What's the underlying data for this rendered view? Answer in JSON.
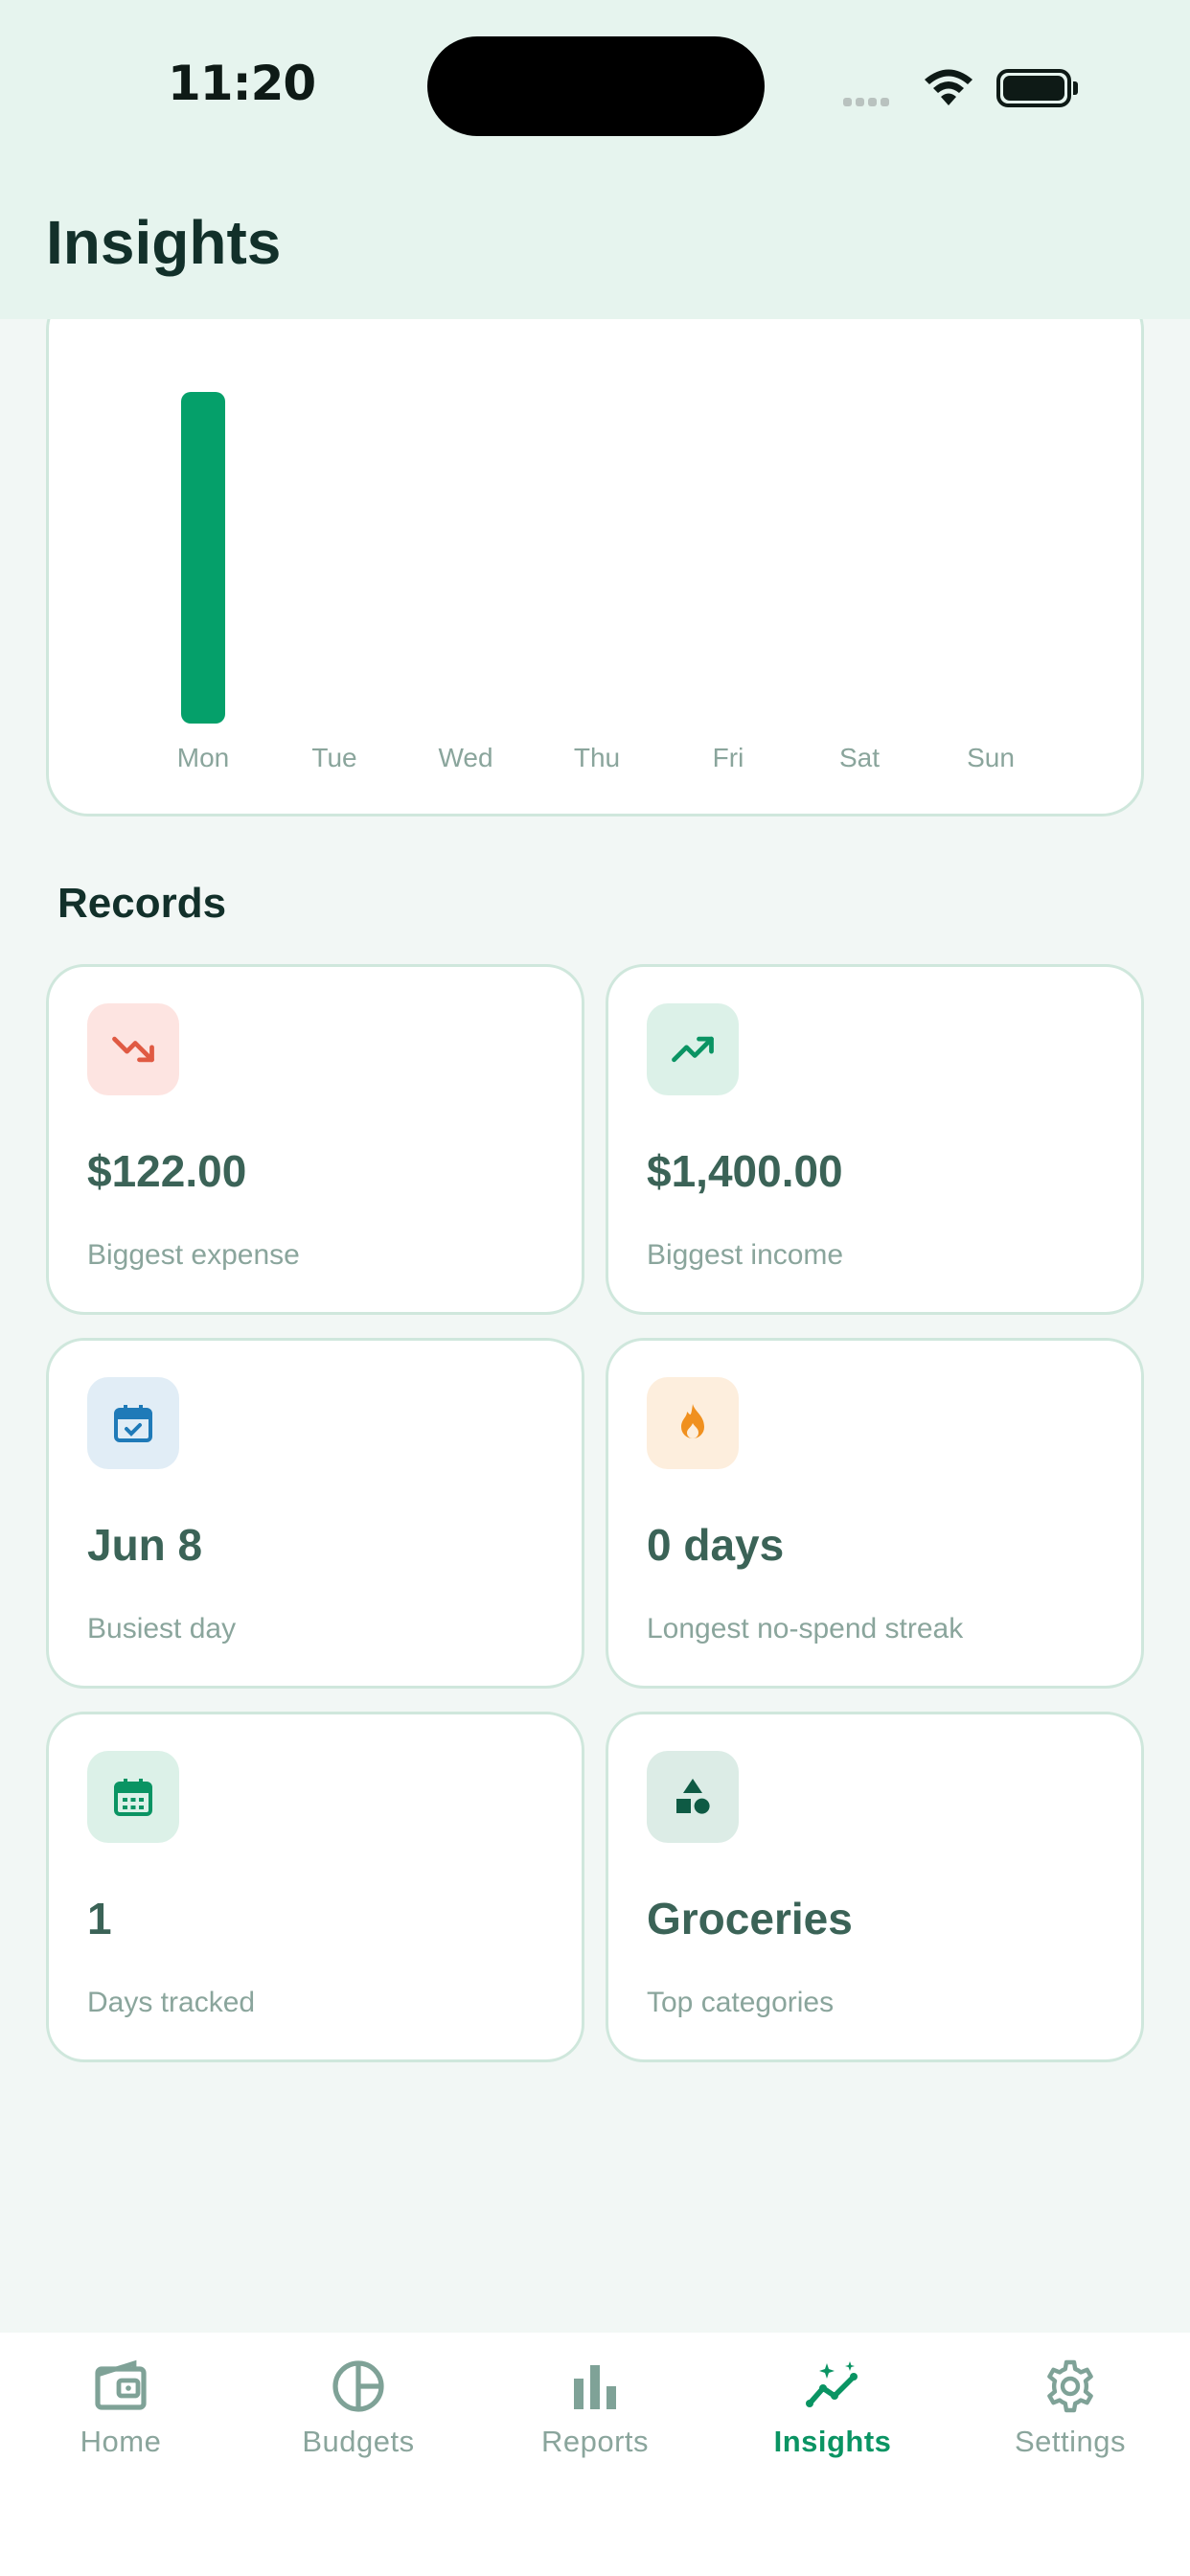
{
  "status_bar": {
    "time": "11:20"
  },
  "header": {
    "title": "Insights"
  },
  "chart_data": {
    "type": "bar",
    "categories": [
      "Mon",
      "Tue",
      "Wed",
      "Thu",
      "Fri",
      "Sat",
      "Sun"
    ],
    "values": [
      1,
      0,
      0,
      0,
      0,
      0,
      0
    ],
    "bar_color": "#05a06a",
    "title": "",
    "xlabel": "",
    "ylabel": ""
  },
  "records": {
    "title": "Records",
    "cards": [
      {
        "value": "$122.00",
        "label": "Biggest expense",
        "icon": "trending-down-icon",
        "badge_color": "#fde4e1",
        "icon_color": "#e05a43"
      },
      {
        "value": "$1,400.00",
        "label": "Biggest income",
        "icon": "trending-up-icon",
        "badge_color": "#dcf1e8",
        "icon_color": "#0a9463"
      },
      {
        "value": "Jun 8",
        "label": "Busiest day",
        "icon": "calendar-check-icon",
        "badge_color": "#e1edf6",
        "icon_color": "#1f7ab8"
      },
      {
        "value": "0 days",
        "label": "Longest no-spend streak",
        "icon": "flame-icon",
        "badge_color": "#fdeedd",
        "icon_color": "#f0901f"
      },
      {
        "value": "1",
        "label": "Days tracked",
        "icon": "calendar-grid-icon",
        "badge_color": "#dcf1e8",
        "icon_color": "#0a9463"
      },
      {
        "value": "Groceries",
        "label": "Top categories",
        "icon": "category-shapes-icon",
        "badge_color": "#dcece6",
        "icon_color": "#0e5a44"
      }
    ]
  },
  "tabbar": {
    "items": [
      {
        "label": "Home",
        "icon": "wallet-icon",
        "active": false
      },
      {
        "label": "Budgets",
        "icon": "pie-chart-icon",
        "active": false
      },
      {
        "label": "Reports",
        "icon": "bar-chart-icon",
        "active": false
      },
      {
        "label": "Insights",
        "icon": "sparkle-trend-icon",
        "active": true
      },
      {
        "label": "Settings",
        "icon": "gear-icon",
        "active": false
      }
    ],
    "active_color": "#0a9463",
    "inactive_color": "#7fa297"
  }
}
